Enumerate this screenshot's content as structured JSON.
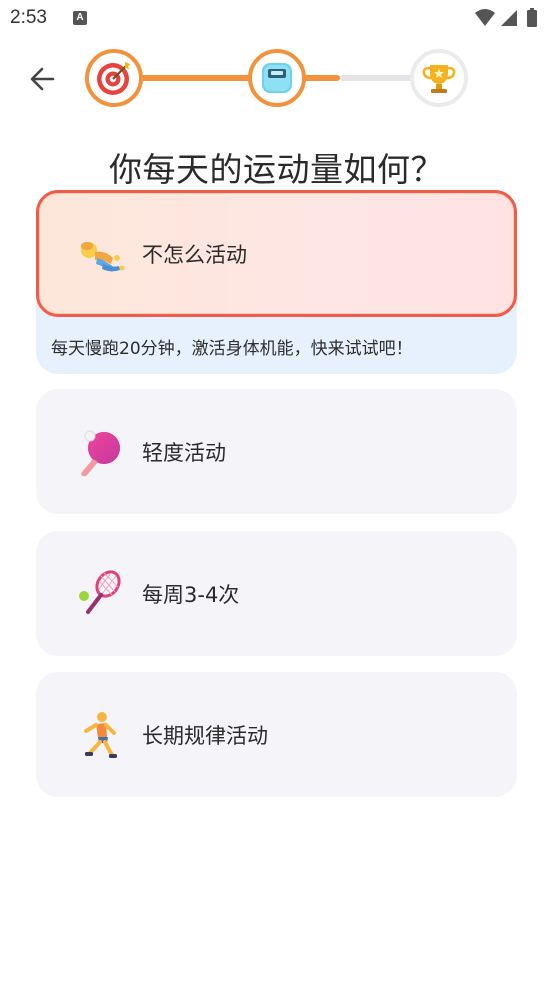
{
  "status_bar": {
    "time": "2:53",
    "notification_icon": "A",
    "icons": [
      "wifi-icon",
      "signal-icon",
      "battery-icon"
    ]
  },
  "header": {
    "back_icon": "arrow-left-icon",
    "progress_steps": [
      {
        "icon": "target-icon",
        "state": "completed"
      },
      {
        "icon": "scale-icon",
        "state": "current"
      },
      {
        "icon": "trophy-icon",
        "state": "pending"
      }
    ],
    "progress_fill": 0.7
  },
  "question": "你每天的运动量如何？",
  "options": [
    {
      "label": "不怎么活动",
      "icon": "lying-person-icon",
      "selected": true,
      "description": "每天慢跑20分钟，激活身体机能，快来试试吧！"
    },
    {
      "label": "轻度活动",
      "icon": "ping-pong-icon",
      "selected": false
    },
    {
      "label": "每周3-4次",
      "icon": "tennis-racket-icon",
      "selected": false
    },
    {
      "label": "长期规律活动",
      "icon": "running-person-icon",
      "selected": false
    }
  ],
  "colors": {
    "accent_orange": "#f2923c",
    "selected_border": "#f25a4a",
    "option_bg": "#f5f4f9",
    "description_bg": "#e7f1fd"
  }
}
